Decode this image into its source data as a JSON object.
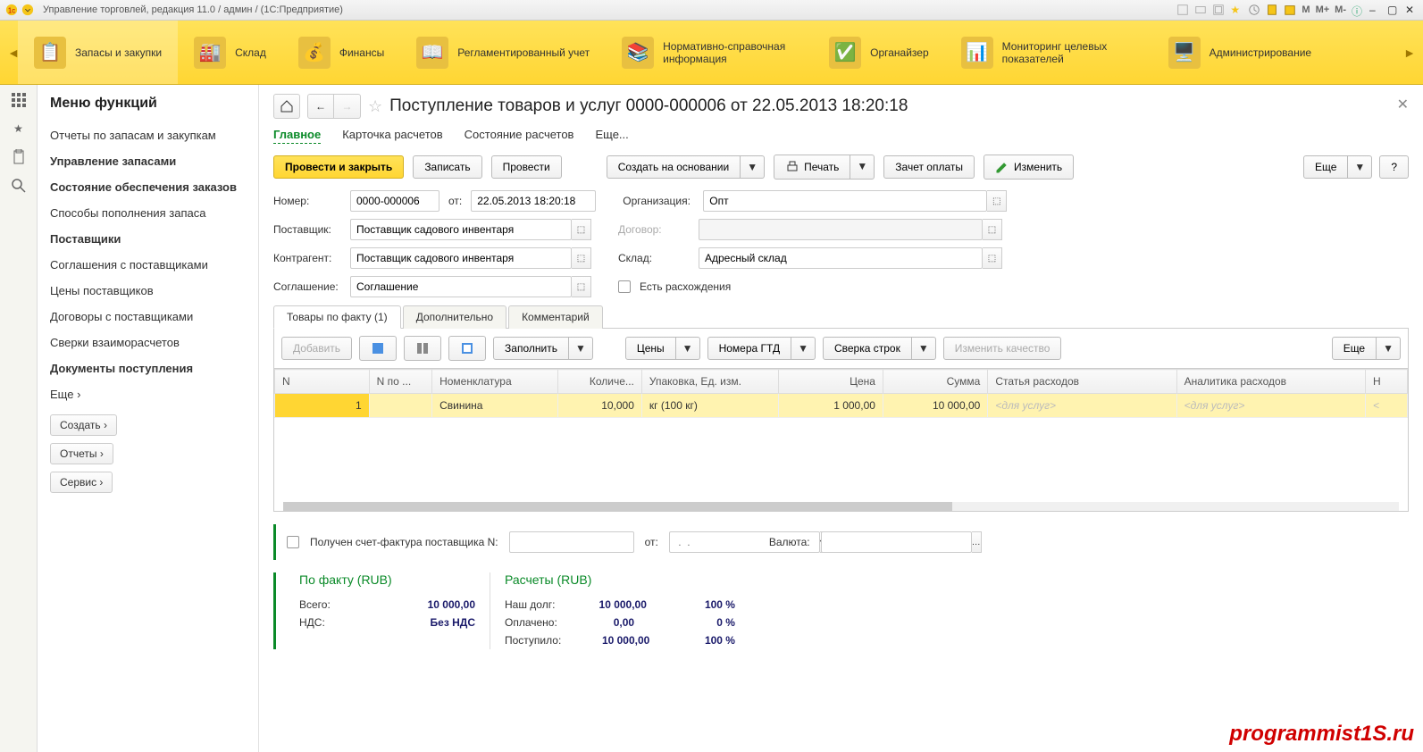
{
  "titlebar": {
    "text": "Управление торговлей, редакция 11.0 / админ /   (1С:Предприятие)",
    "m_buttons": [
      "M",
      "M+",
      "M-"
    ]
  },
  "main_nav": {
    "items": [
      {
        "label": "Запасы и закупки",
        "active": true
      },
      {
        "label": "Склад"
      },
      {
        "label": "Финансы"
      },
      {
        "label": "Регламентированный учет"
      },
      {
        "label": "Нормативно-справочная информация"
      },
      {
        "label": "Органайзер"
      },
      {
        "label": "Мониторинг целевых показателей"
      },
      {
        "label": "Администрирование"
      }
    ]
  },
  "sidebar": {
    "title": "Меню функций",
    "items": [
      {
        "label": "Отчеты по запасам и закупкам"
      },
      {
        "label": "Управление запасами",
        "bold": true
      },
      {
        "label": "Состояние обеспечения заказов",
        "bold": true
      },
      {
        "label": "Способы пополнения запаса"
      },
      {
        "label": "Поставщики",
        "bold": true
      },
      {
        "label": "Соглашения с поставщиками"
      },
      {
        "label": "Цены поставщиков"
      },
      {
        "label": "Договоры с поставщиками"
      },
      {
        "label": "Сверки взаиморасчетов"
      },
      {
        "label": "Документы поступления",
        "bold": true
      },
      {
        "label": "Еще ›"
      }
    ],
    "buttons": [
      "Создать ›",
      "Отчеты ›",
      "Сервис ›"
    ]
  },
  "document": {
    "title": "Поступление товаров и услуг 0000-000006 от 22.05.2013 18:20:18",
    "nav_tabs": [
      "Главное",
      "Карточка расчетов",
      "Состояние расчетов",
      "Еще..."
    ],
    "commands": {
      "post_close": "Провести и закрыть",
      "save": "Записать",
      "post": "Провести",
      "create_based": "Создать на основании",
      "print": "Печать",
      "offset": "Зачет оплаты",
      "edit": "Изменить",
      "more": "Еще",
      "help": "?"
    },
    "fields": {
      "number_label": "Номер:",
      "number_value": "0000-000006",
      "date_label": "от:",
      "date_value": "22.05.2013 18:20:18",
      "org_label": "Организация:",
      "org_value": "Опт",
      "supplier_label": "Поставщик:",
      "supplier_value": "Поставщик садового инвентаря",
      "contract_label": "Договор:",
      "contract_value": "",
      "contragent_label": "Контрагент:",
      "contragent_value": "Поставщик садового инвентаря",
      "warehouse_label": "Склад:",
      "warehouse_value": "Адресный склад",
      "agreement_label": "Соглашение:",
      "agreement_value": "Соглашение",
      "discrepancy_label": "Есть расхождения"
    },
    "inner_tabs": [
      "Товары по факту (1)",
      "Дополнительно",
      "Комментарий"
    ],
    "tab_toolbar": {
      "add": "Добавить",
      "fill": "Заполнить",
      "prices": "Цены",
      "gtd": "Номера ГТД",
      "reconcile": "Сверка строк",
      "quality": "Изменить качество",
      "more": "Еще"
    },
    "table": {
      "columns": [
        "N",
        "N по ...",
        "Номенклатура",
        "Количе...",
        "Упаковка, Ед. изм.",
        "Цена",
        "Сумма",
        "Статья расходов",
        "Аналитика расходов",
        "Н"
      ],
      "rows": [
        {
          "n": "1",
          "nby": "",
          "item": "Свинина",
          "qty": "10,000",
          "unit": "кг (100 кг)",
          "price": "1 000,00",
          "sum": "10 000,00",
          "exp_cat": "<для услуг>",
          "exp_anal": "<для услуг>",
          "last": "<"
        }
      ]
    },
    "invoice": {
      "received_label": "Получен счет-фактура поставщика N:",
      "from_label": "от:",
      "date_placeholder": " .  .",
      "currency_label": "Валюта:"
    },
    "totals": {
      "fact_title": "По факту (RUB)",
      "calc_title": "Расчеты (RUB)",
      "fact": [
        {
          "label": "Всего:",
          "value": "10 000,00"
        },
        {
          "label": "НДС:",
          "value": "Без НДС"
        }
      ],
      "calc": [
        {
          "label": "Наш долг:",
          "value": "10 000,00",
          "pct": "100 %"
        },
        {
          "label": "Оплачено:",
          "value": "0,00",
          "pct": "0 %"
        },
        {
          "label": "Поступило:",
          "value": "10 000,00",
          "pct": "100 %"
        }
      ]
    }
  },
  "watermark": "programmist1S.ru"
}
